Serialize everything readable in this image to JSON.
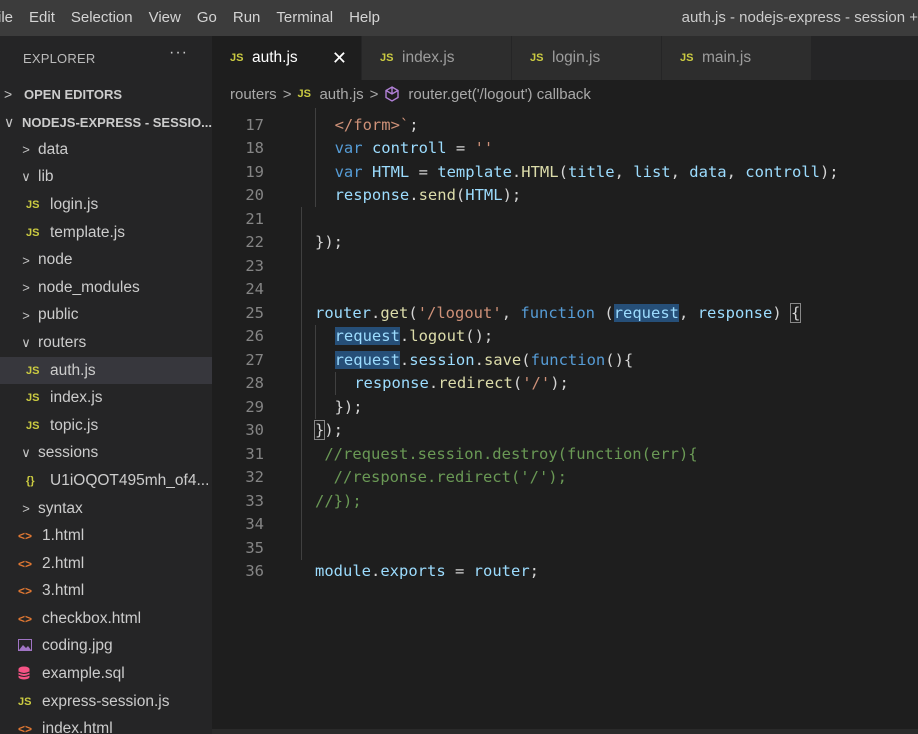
{
  "menubar": {
    "items": [
      "ile",
      "Edit",
      "Selection",
      "View",
      "Go",
      "Run",
      "Terminal",
      "Help"
    ],
    "window_title": "auth.js - nodejs-express - session +"
  },
  "sidebar": {
    "header": "EXPLORER",
    "more": "···",
    "open_editors": "OPEN EDITORS",
    "project": "NODEJS-EXPRESS - SESSIO...",
    "tree": [
      {
        "label": "data",
        "type": "folder",
        "open": false,
        "depth": 0
      },
      {
        "label": "lib",
        "type": "folder",
        "open": true,
        "depth": 0
      },
      {
        "label": "login.js",
        "type": "js",
        "depth": 1
      },
      {
        "label": "template.js",
        "type": "js",
        "depth": 1
      },
      {
        "label": "node",
        "type": "folder",
        "open": false,
        "depth": 0
      },
      {
        "label": "node_modules",
        "type": "folder",
        "open": false,
        "depth": 0
      },
      {
        "label": "public",
        "type": "folder",
        "open": false,
        "depth": 0
      },
      {
        "label": "routers",
        "type": "folder",
        "open": true,
        "depth": 0
      },
      {
        "label": "auth.js",
        "type": "js",
        "depth": 1,
        "active": true
      },
      {
        "label": "index.js",
        "type": "js",
        "depth": 1
      },
      {
        "label": "topic.js",
        "type": "js",
        "depth": 1
      },
      {
        "label": "sessions",
        "type": "folder",
        "open": true,
        "depth": 0
      },
      {
        "label": "U1iOQOT495mh_of4...",
        "type": "json",
        "depth": 1
      },
      {
        "label": "syntax",
        "type": "folder",
        "open": false,
        "depth": 0
      },
      {
        "label": "1.html",
        "type": "html",
        "depth": 0
      },
      {
        "label": "2.html",
        "type": "html",
        "depth": 0
      },
      {
        "label": "3.html",
        "type": "html",
        "depth": 0
      },
      {
        "label": "checkbox.html",
        "type": "html",
        "depth": 0
      },
      {
        "label": "coding.jpg",
        "type": "img",
        "depth": 0
      },
      {
        "label": "example.sql",
        "type": "db",
        "depth": 0
      },
      {
        "label": "express-session.js",
        "type": "js",
        "depth": 0
      },
      {
        "label": "index.html",
        "type": "html",
        "depth": 0
      }
    ]
  },
  "tabs": [
    {
      "label": "auth.js",
      "active": true,
      "close": "✕"
    },
    {
      "label": "index.js",
      "active": false
    },
    {
      "label": "login.js",
      "active": false
    },
    {
      "label": "main.js",
      "active": false
    }
  ],
  "icons": {
    "js": "JS",
    "html": "<>",
    "json": "{}",
    "chev_open": "∨",
    "chev_closed": ">"
  },
  "breadcrumb": {
    "folder": "routers",
    "file": "auth.js",
    "symbol": "router.get('/logout') callback"
  },
  "editor": {
    "lines": [
      {
        "n": "17",
        "i": 1,
        "t": [
          [
            "</form>`",
            "str"
          ],
          [
            ";",
            "pl"
          ]
        ]
      },
      {
        "n": "18",
        "i": 1,
        "t": [
          [
            "var",
            "kw"
          ],
          [
            " ",
            "pl"
          ],
          [
            "controll",
            "var"
          ],
          [
            " = ",
            "pl"
          ],
          [
            "''",
            "str"
          ]
        ]
      },
      {
        "n": "19",
        "i": 1,
        "t": [
          [
            "var",
            "kw"
          ],
          [
            " ",
            "pl"
          ],
          [
            "HTML",
            "var"
          ],
          [
            " = ",
            "pl"
          ],
          [
            "template",
            "var"
          ],
          [
            ".",
            "pl"
          ],
          [
            "HTML",
            "fn"
          ],
          [
            "(",
            "pl"
          ],
          [
            "title",
            "var"
          ],
          [
            ", ",
            "pl"
          ],
          [
            "list",
            "var"
          ],
          [
            ", ",
            "pl"
          ],
          [
            "data",
            "var"
          ],
          [
            ", ",
            "pl"
          ],
          [
            "controll",
            "var"
          ],
          [
            ");",
            "pl"
          ]
        ]
      },
      {
        "n": "20",
        "i": 1,
        "t": [
          [
            "response",
            "var"
          ],
          [
            ".",
            "pl"
          ],
          [
            "send",
            "fn"
          ],
          [
            "(",
            "pl"
          ],
          [
            "HTML",
            "var"
          ],
          [
            ");",
            "pl"
          ]
        ]
      },
      {
        "n": "21",
        "i": 0,
        "t": []
      },
      {
        "n": "22",
        "i": 0,
        "t": [
          [
            "});",
            "pl"
          ]
        ]
      },
      {
        "n": "23",
        "i": 0,
        "t": []
      },
      {
        "n": "24",
        "i": 0,
        "t": []
      },
      {
        "n": "25",
        "i": 0,
        "t": [
          [
            "router",
            "var"
          ],
          [
            ".",
            "pl"
          ],
          [
            "get",
            "fn"
          ],
          [
            "(",
            "pl"
          ],
          [
            "'/logout'",
            "str"
          ],
          [
            ", ",
            "pl"
          ],
          [
            "function",
            "kw"
          ],
          [
            " (",
            "pl"
          ],
          [
            "request",
            "var hl"
          ],
          [
            ", ",
            "pl"
          ],
          [
            "response",
            "var"
          ],
          [
            ") ",
            "pl"
          ],
          [
            "{",
            "pl bracket"
          ]
        ]
      },
      {
        "n": "26",
        "i": 1,
        "t": [
          [
            "request",
            "var hl"
          ],
          [
            ".",
            "pl"
          ],
          [
            "logout",
            "fn"
          ],
          [
            "();",
            "pl"
          ]
        ]
      },
      {
        "n": "27",
        "i": 1,
        "t": [
          [
            "request",
            "var hl"
          ],
          [
            ".",
            "pl"
          ],
          [
            "session",
            "var"
          ],
          [
            ".",
            "pl"
          ],
          [
            "save",
            "fn"
          ],
          [
            "(",
            "pl"
          ],
          [
            "function",
            "kw"
          ],
          [
            "(){",
            "pl"
          ]
        ]
      },
      {
        "n": "28",
        "i": 2,
        "t": [
          [
            "response",
            "var"
          ],
          [
            ".",
            "pl"
          ],
          [
            "redirect",
            "fn"
          ],
          [
            "(",
            "pl"
          ],
          [
            "'/'",
            "str"
          ],
          [
            ");",
            "pl"
          ]
        ]
      },
      {
        "n": "29",
        "i": 1,
        "t": [
          [
            "});",
            "pl"
          ]
        ]
      },
      {
        "n": "30",
        "i": 0,
        "t": [
          [
            "}",
            "pl bracket"
          ],
          [
            ");",
            "pl"
          ]
        ]
      },
      {
        "n": "31",
        "i": 0,
        "t": [
          [
            " //request.session.destroy(function(err){",
            "cmt"
          ]
        ]
      },
      {
        "n": "32",
        "i": 0,
        "t": [
          [
            "  //response.redirect('/');",
            "cmt"
          ]
        ]
      },
      {
        "n": "33",
        "i": 0,
        "t": [
          [
            "//});",
            "cmt"
          ]
        ]
      },
      {
        "n": "34",
        "i": 0,
        "t": []
      },
      {
        "n": "35",
        "i": 0,
        "t": []
      },
      {
        "n": "36",
        "i": 0,
        "t": [
          [
            "module",
            "var"
          ],
          [
            ".",
            "pl"
          ],
          [
            "exports",
            "var"
          ],
          [
            " = ",
            "pl"
          ],
          [
            "router",
            "var"
          ],
          [
            ";",
            "pl"
          ]
        ]
      }
    ]
  }
}
